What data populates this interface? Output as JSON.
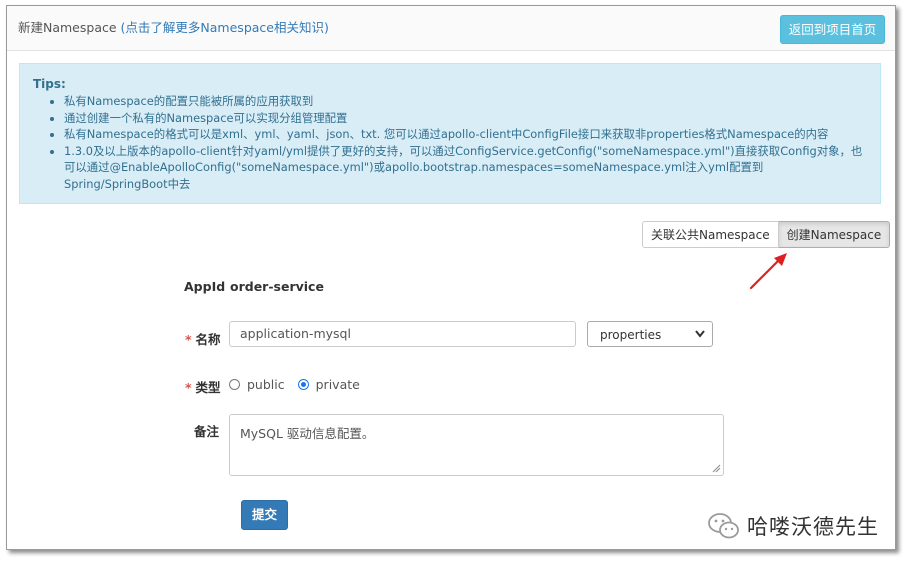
{
  "header": {
    "title": "新建Namespace",
    "link_text": "(点击了解更多Namespace相关知识)",
    "back_button": "返回到项目首页"
  },
  "tips": {
    "title": "Tips:",
    "items": [
      "私有Namespace的配置只能被所属的应用获取到",
      "通过创建一个私有的Namespace可以实现分组管理配置",
      "私有Namespace的格式可以是xml、yml、yaml、json、txt. 您可以通过apollo-client中ConfigFile接口来获取非properties格式Namespace的内容",
      "1.3.0及以上版本的apollo-client针对yaml/yml提供了更好的支持，可以通过ConfigService.getConfig(\"someNamespace.yml\")直接获取Config对象，也可以通过@EnableApolloConfig(\"someNamespace.yml\")或apollo.bootstrap.namespaces=someNamespace.yml注入yml配置到Spring/SpringBoot中去"
    ]
  },
  "mode_buttons": {
    "associate": "关联公共Namespace",
    "create": "创建Namespace"
  },
  "form": {
    "appid_label": "AppId",
    "appid_value": "order-service",
    "required_mark": "*",
    "name_label": "名称",
    "name_value": "application-mysql",
    "format_selected": "properties",
    "type_label": "类型",
    "type_public": "public",
    "type_private": "private",
    "type_selected": "private",
    "comment_label": "备注",
    "comment_value": "MySQL 驱动信息配置。",
    "submit": "提交"
  },
  "watermark": {
    "text": "哈喽沃德先生"
  },
  "colors": {
    "primary": "#337ab7",
    "info": "#5bc0de",
    "tips_bg": "#d9edf7",
    "tips_text": "#31708f",
    "required": "#d9534f",
    "annotation_arrow": "#e02020"
  }
}
